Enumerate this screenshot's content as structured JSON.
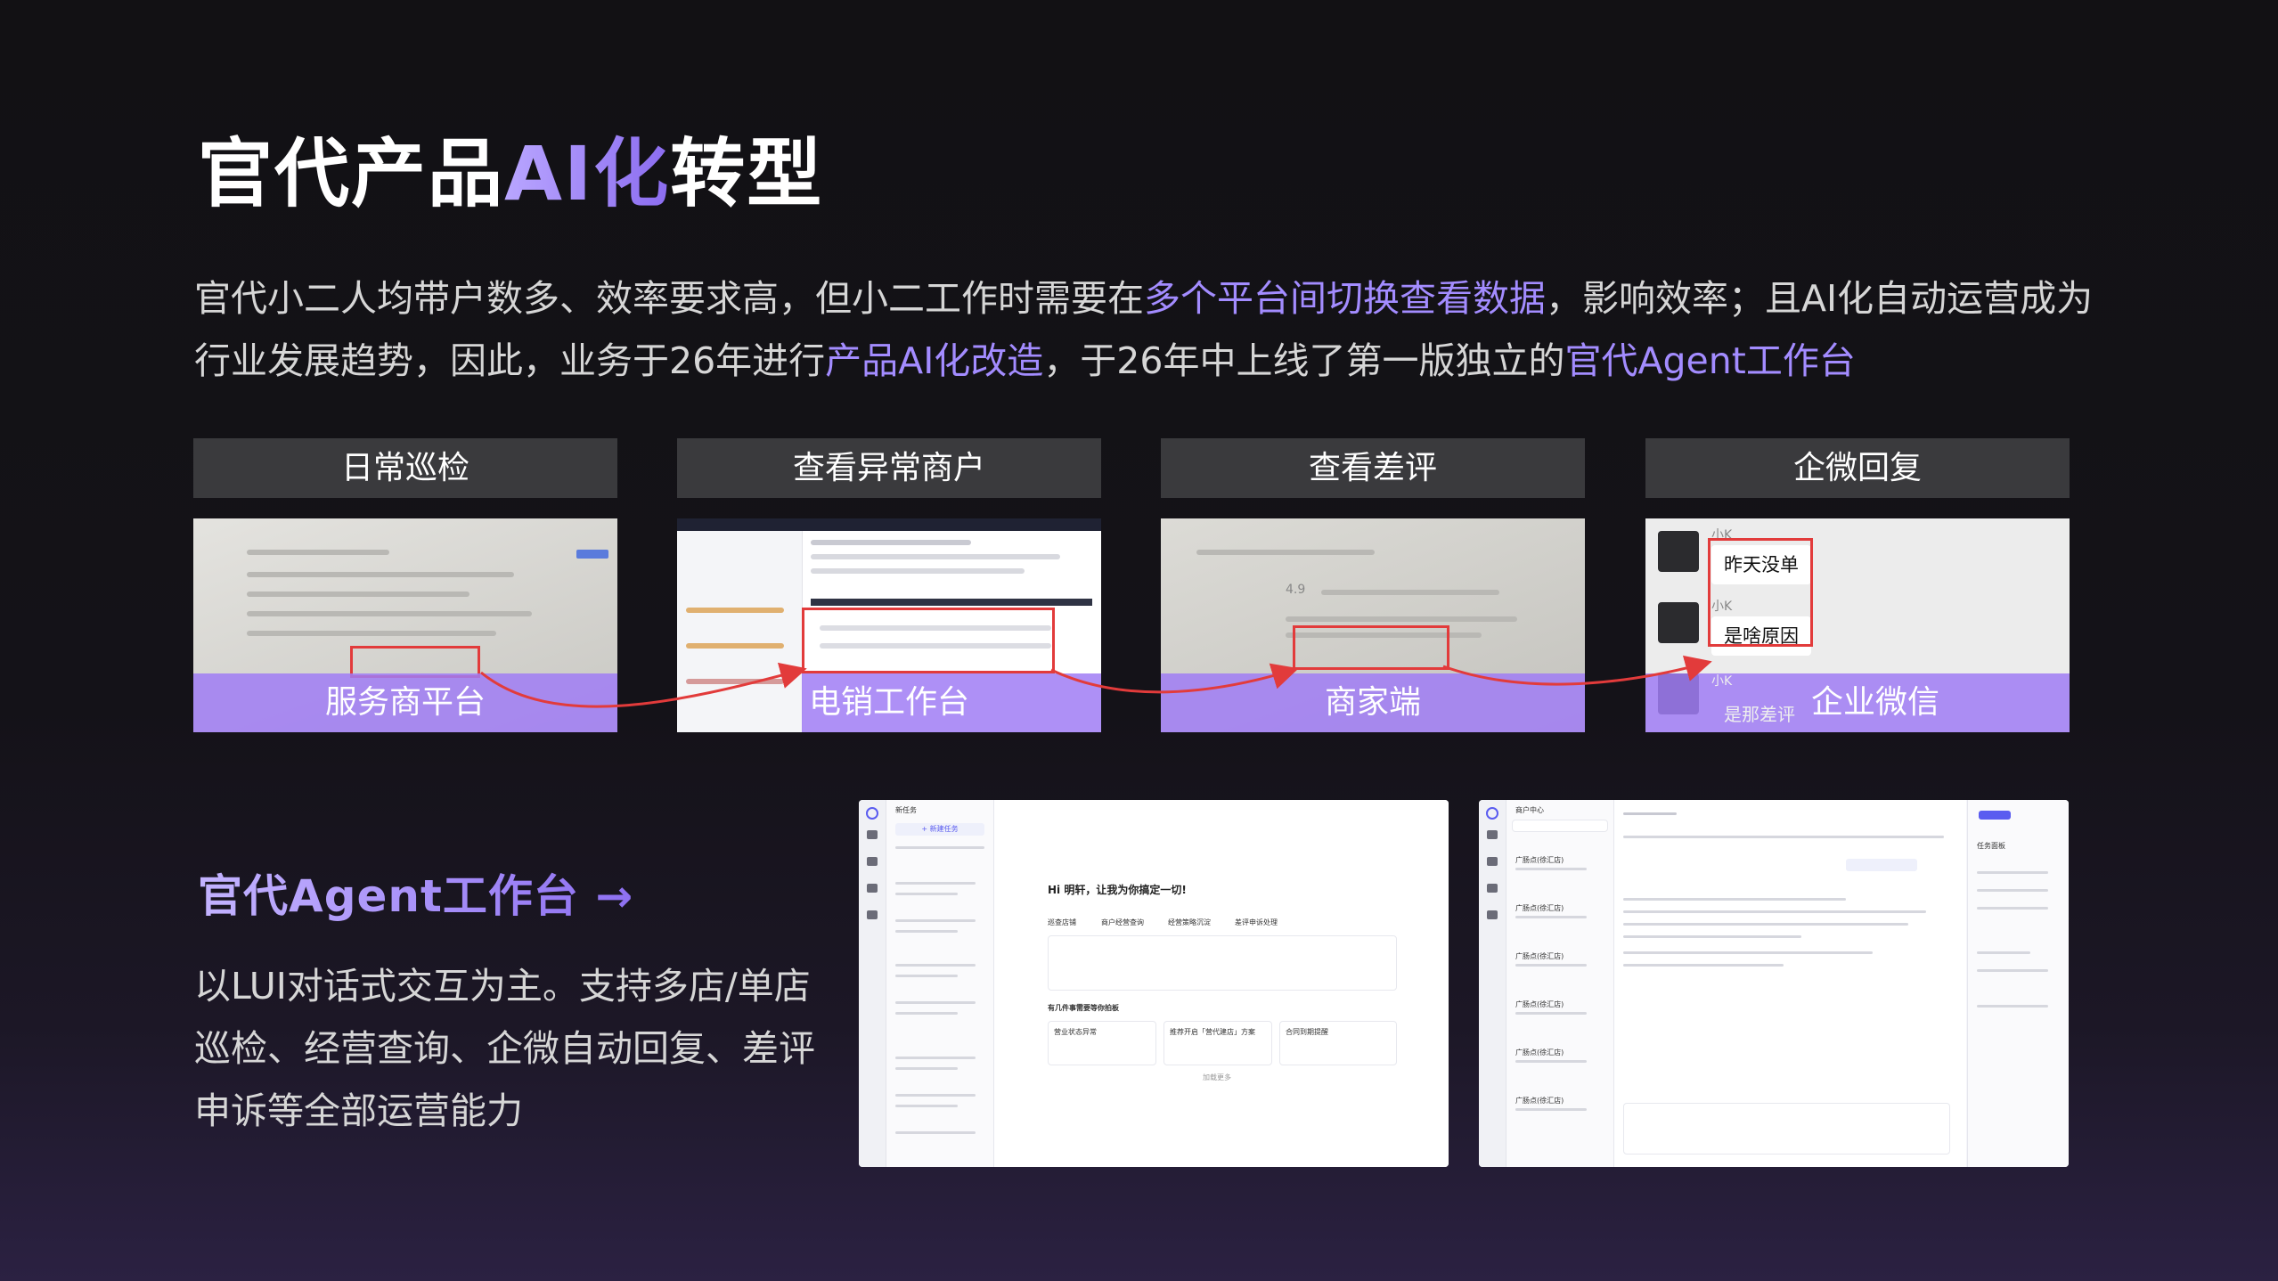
{
  "title": {
    "prefix": "官代产品",
    "highlight": "AI化",
    "suffix": "转型"
  },
  "intro": {
    "p1": "官代小二人均带户数多、效率要求高，但小二工作时需要在",
    "hl1": "多个平台间切换查看数据",
    "p2": "，影响效率；且AI化自动运营成为行业发展趋势，因此，业务于26年进行",
    "hl2": "产品AI化改造",
    "p3": "，于26年中上线了第一版独立的",
    "hl3": "官代Agent工作台"
  },
  "stages": [
    {
      "label": "日常巡检",
      "platform": "服务商平台"
    },
    {
      "label": "查看异常商户",
      "platform": "电销工作台"
    },
    {
      "label": "查看差评",
      "platform": "商家端"
    },
    {
      "label": "企微回复",
      "platform": "企业微信"
    }
  ],
  "wechat": {
    "sender": "小K",
    "messages": [
      "昨天没单",
      "是啥原因",
      "是那差评"
    ]
  },
  "agent": {
    "title": "官代Agent工作台",
    "arrow": "→",
    "desc": "以LUI对话式交互为主。支持多店/单店巡检、经营查询、企微自动回复、差评申诉等全部运营能力"
  },
  "panel1": {
    "list_title": "新任务",
    "new_task": "+ 新建任务",
    "greeting": "Hi 明轩，让我为你搞定一切!",
    "chips": [
      "巡查店铺",
      "商户经营查询",
      "经营策略沉淀",
      "差评申诉处理"
    ],
    "section": "有几件事需要等你拍板",
    "cards": [
      "营业状态异常",
      "推荐开启「营代建店」方案",
      "合同到期提醒"
    ],
    "more": "加载更多"
  },
  "panel2": {
    "list_title": "商户中心",
    "merchants": [
      "广肠点(徐汇店)",
      "广肠点(徐汇店)",
      "广肠点(徐汇店)",
      "广肠点(徐汇店)",
      "广肠点(徐汇店)",
      "广肠点(徐汇店)"
    ],
    "side_title": "任务面板"
  }
}
